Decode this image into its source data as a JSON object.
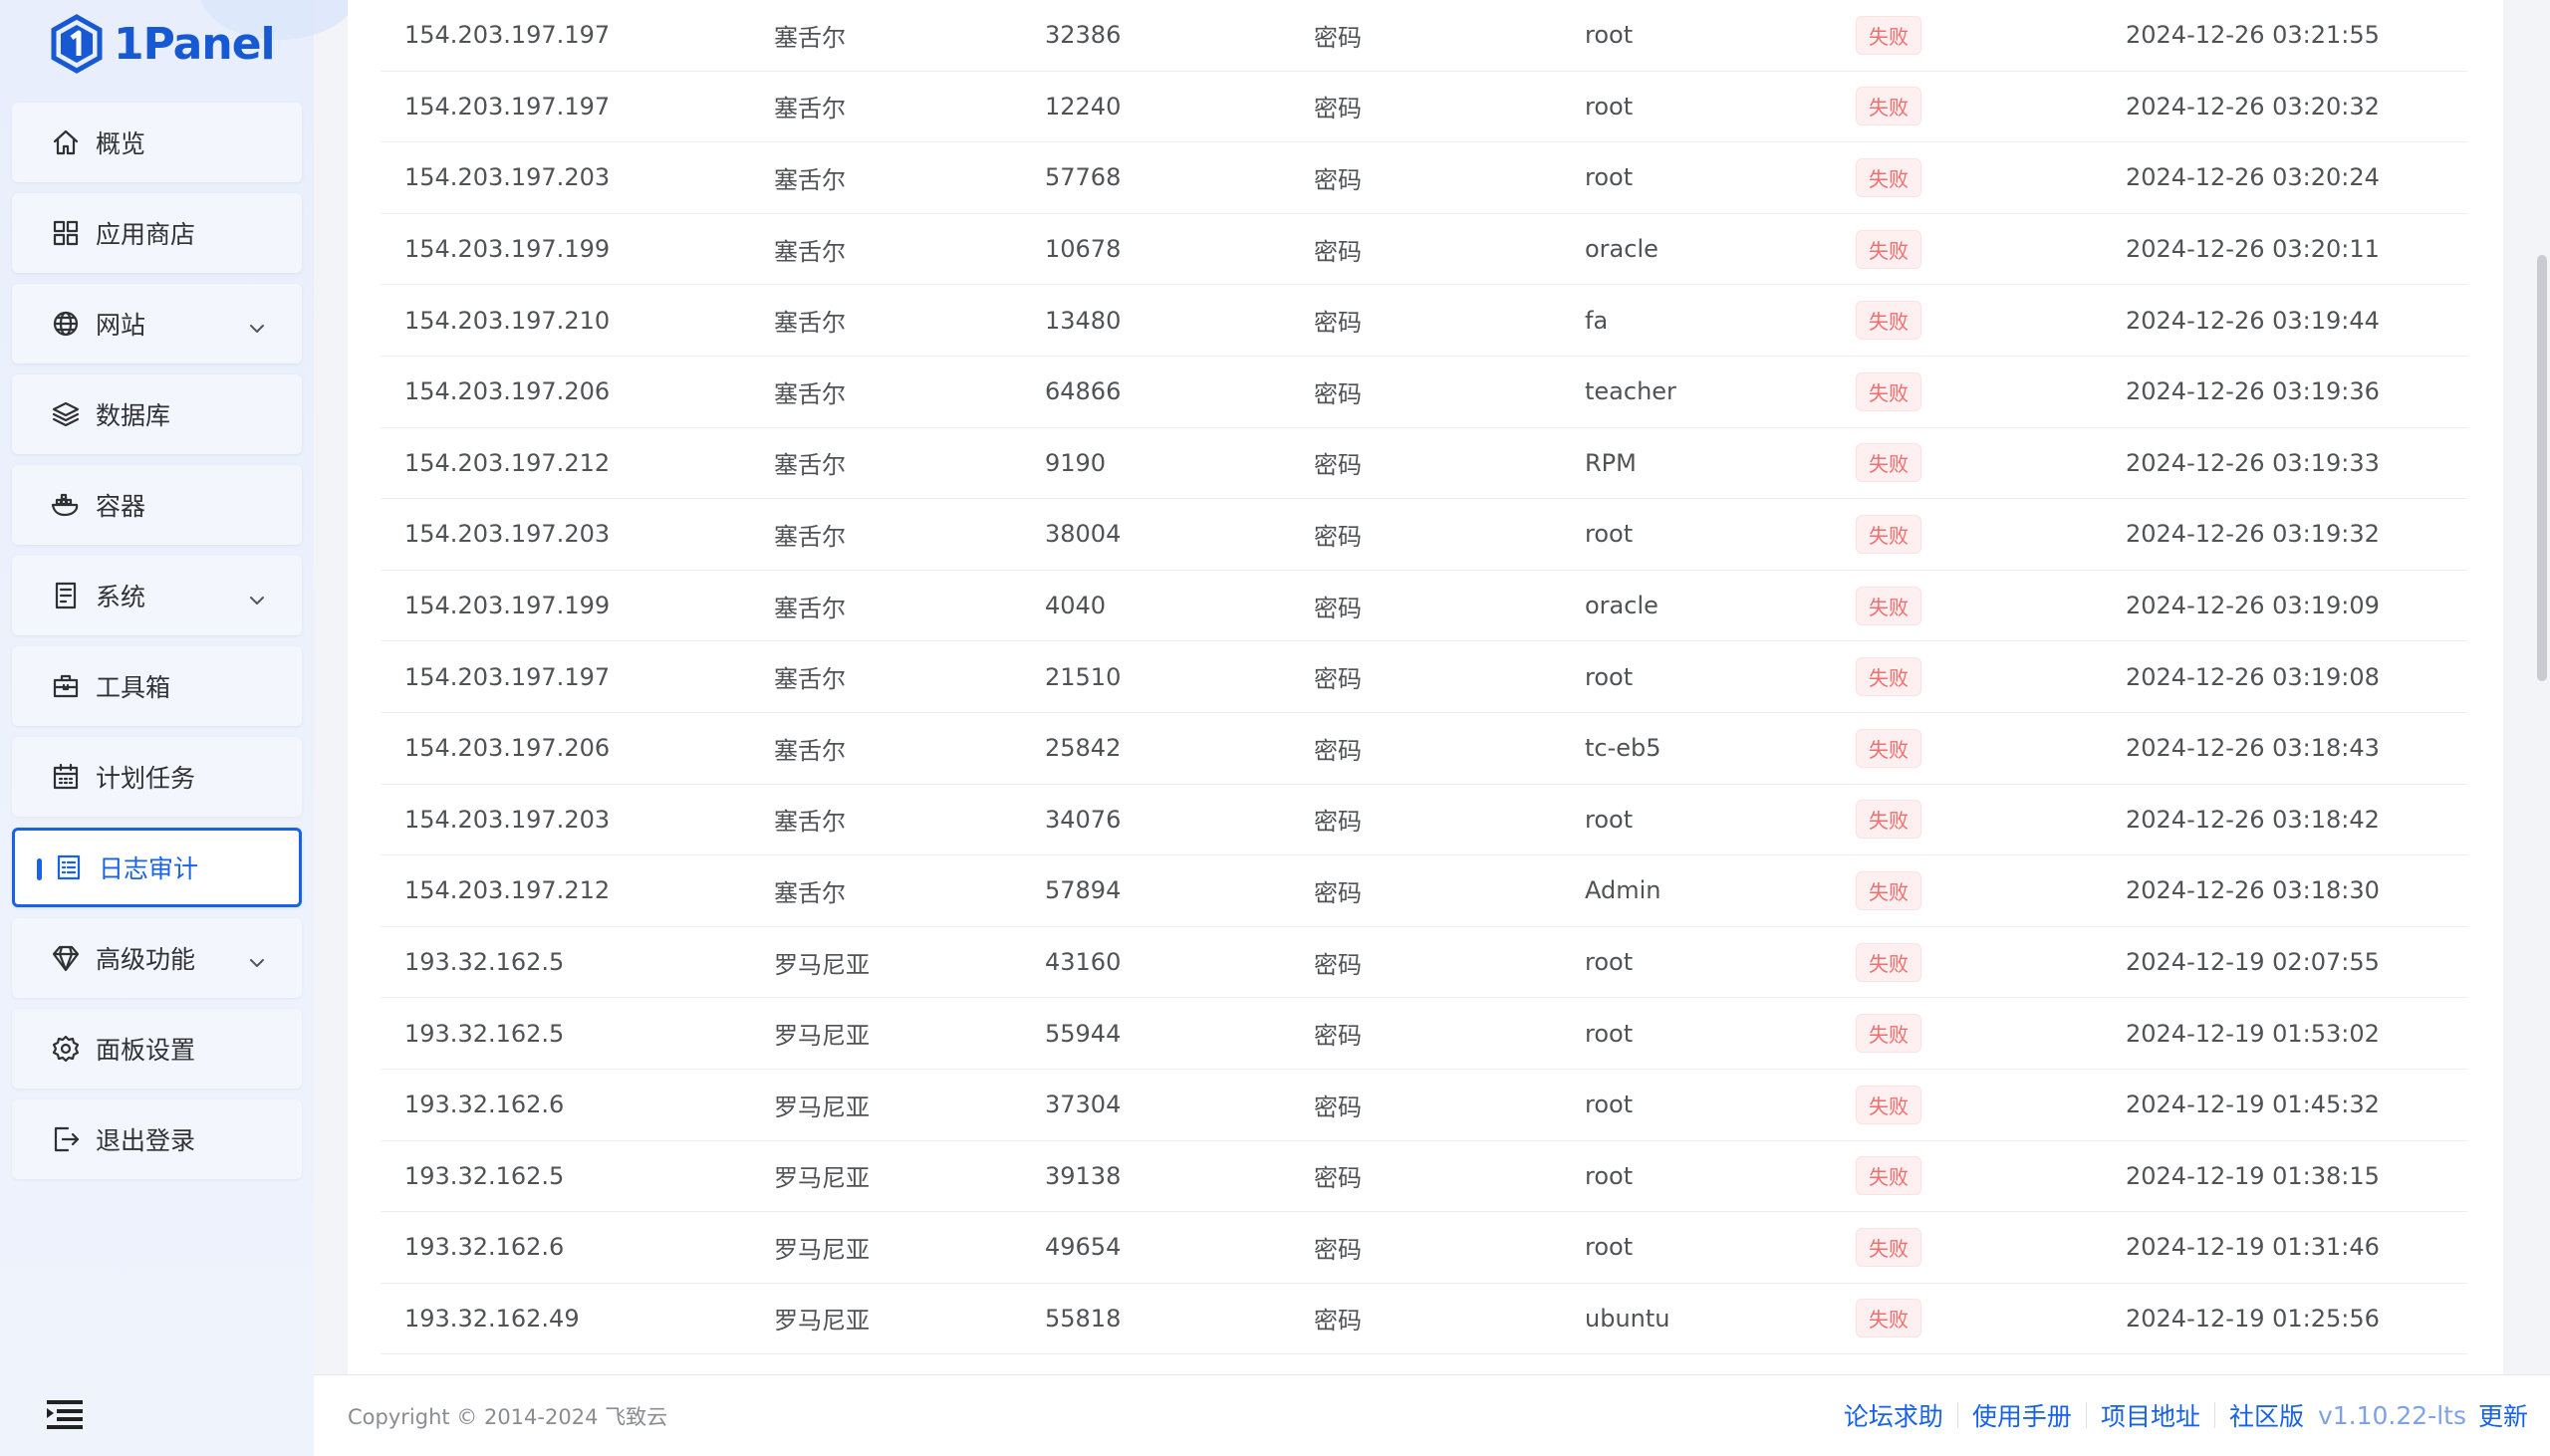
{
  "brand": {
    "name": "1Panel"
  },
  "sidebar": {
    "items": [
      {
        "label": "概览",
        "icon": "home-icon",
        "expandable": false,
        "active": false
      },
      {
        "label": "应用商店",
        "icon": "grid-icon",
        "expandable": false,
        "active": false
      },
      {
        "label": "网站",
        "icon": "globe-icon",
        "expandable": true,
        "active": false
      },
      {
        "label": "数据库",
        "icon": "layers-icon",
        "expandable": false,
        "active": false
      },
      {
        "label": "容器",
        "icon": "docker-icon",
        "expandable": false,
        "active": false
      },
      {
        "label": "系统",
        "icon": "server-icon",
        "expandable": true,
        "active": false
      },
      {
        "label": "工具箱",
        "icon": "toolbox-icon",
        "expandable": false,
        "active": false
      },
      {
        "label": "计划任务",
        "icon": "calendar-icon",
        "expandable": false,
        "active": false
      },
      {
        "label": "日志审计",
        "icon": "log-icon",
        "expandable": false,
        "active": true
      },
      {
        "label": "高级功能",
        "icon": "diamond-icon",
        "expandable": true,
        "active": false
      },
      {
        "label": "面板设置",
        "icon": "gear-icon",
        "expandable": false,
        "active": false
      },
      {
        "label": "退出登录",
        "icon": "logout-icon",
        "expandable": false,
        "active": false
      }
    ]
  },
  "login_log": {
    "rows": [
      {
        "ip": "154.203.197.197",
        "area": "塞舌尔",
        "port": "32386",
        "auth": "密码",
        "user": "root",
        "status": "失败",
        "time": "2024-12-26 03:21:55"
      },
      {
        "ip": "154.203.197.197",
        "area": "塞舌尔",
        "port": "12240",
        "auth": "密码",
        "user": "root",
        "status": "失败",
        "time": "2024-12-26 03:20:32"
      },
      {
        "ip": "154.203.197.203",
        "area": "塞舌尔",
        "port": "57768",
        "auth": "密码",
        "user": "root",
        "status": "失败",
        "time": "2024-12-26 03:20:24"
      },
      {
        "ip": "154.203.197.199",
        "area": "塞舌尔",
        "port": "10678",
        "auth": "密码",
        "user": "oracle",
        "status": "失败",
        "time": "2024-12-26 03:20:11"
      },
      {
        "ip": "154.203.197.210",
        "area": "塞舌尔",
        "port": "13480",
        "auth": "密码",
        "user": "fa",
        "status": "失败",
        "time": "2024-12-26 03:19:44"
      },
      {
        "ip": "154.203.197.206",
        "area": "塞舌尔",
        "port": "64866",
        "auth": "密码",
        "user": "teacher",
        "status": "失败",
        "time": "2024-12-26 03:19:36"
      },
      {
        "ip": "154.203.197.212",
        "area": "塞舌尔",
        "port": "9190",
        "auth": "密码",
        "user": "RPM",
        "status": "失败",
        "time": "2024-12-26 03:19:33"
      },
      {
        "ip": "154.203.197.203",
        "area": "塞舌尔",
        "port": "38004",
        "auth": "密码",
        "user": "root",
        "status": "失败",
        "time": "2024-12-26 03:19:32"
      },
      {
        "ip": "154.203.197.199",
        "area": "塞舌尔",
        "port": "4040",
        "auth": "密码",
        "user": "oracle",
        "status": "失败",
        "time": "2024-12-26 03:19:09"
      },
      {
        "ip": "154.203.197.197",
        "area": "塞舌尔",
        "port": "21510",
        "auth": "密码",
        "user": "root",
        "status": "失败",
        "time": "2024-12-26 03:19:08"
      },
      {
        "ip": "154.203.197.206",
        "area": "塞舌尔",
        "port": "25842",
        "auth": "密码",
        "user": "tc-eb5",
        "status": "失败",
        "time": "2024-12-26 03:18:43"
      },
      {
        "ip": "154.203.197.203",
        "area": "塞舌尔",
        "port": "34076",
        "auth": "密码",
        "user": "root",
        "status": "失败",
        "time": "2024-12-26 03:18:42"
      },
      {
        "ip": "154.203.197.212",
        "area": "塞舌尔",
        "port": "57894",
        "auth": "密码",
        "user": "Admin",
        "status": "失败",
        "time": "2024-12-26 03:18:30"
      },
      {
        "ip": "193.32.162.5",
        "area": "罗马尼亚",
        "port": "43160",
        "auth": "密码",
        "user": "root",
        "status": "失败",
        "time": "2024-12-19 02:07:55"
      },
      {
        "ip": "193.32.162.5",
        "area": "罗马尼亚",
        "port": "55944",
        "auth": "密码",
        "user": "root",
        "status": "失败",
        "time": "2024-12-19 01:53:02"
      },
      {
        "ip": "193.32.162.6",
        "area": "罗马尼亚",
        "port": "37304",
        "auth": "密码",
        "user": "root",
        "status": "失败",
        "time": "2024-12-19 01:45:32"
      },
      {
        "ip": "193.32.162.5",
        "area": "罗马尼亚",
        "port": "39138",
        "auth": "密码",
        "user": "root",
        "status": "失败",
        "time": "2024-12-19 01:38:15"
      },
      {
        "ip": "193.32.162.6",
        "area": "罗马尼亚",
        "port": "49654",
        "auth": "密码",
        "user": "root",
        "status": "失败",
        "time": "2024-12-19 01:31:46"
      },
      {
        "ip": "193.32.162.49",
        "area": "罗马尼亚",
        "port": "55818",
        "auth": "密码",
        "user": "ubuntu",
        "status": "失败",
        "time": "2024-12-19 01:25:56"
      }
    ]
  },
  "footer": {
    "copyright": "Copyright © 2014-2024 飞致云",
    "forum": "论坛求助",
    "manual": "使用手册",
    "project": "项目地址",
    "edition": "社区版",
    "version": "v1.10.22-lts",
    "update": "更新"
  },
  "colors": {
    "primary": "#1762e6",
    "danger": "#f56c6c",
    "sidebar_bg": "#e8eefb"
  }
}
